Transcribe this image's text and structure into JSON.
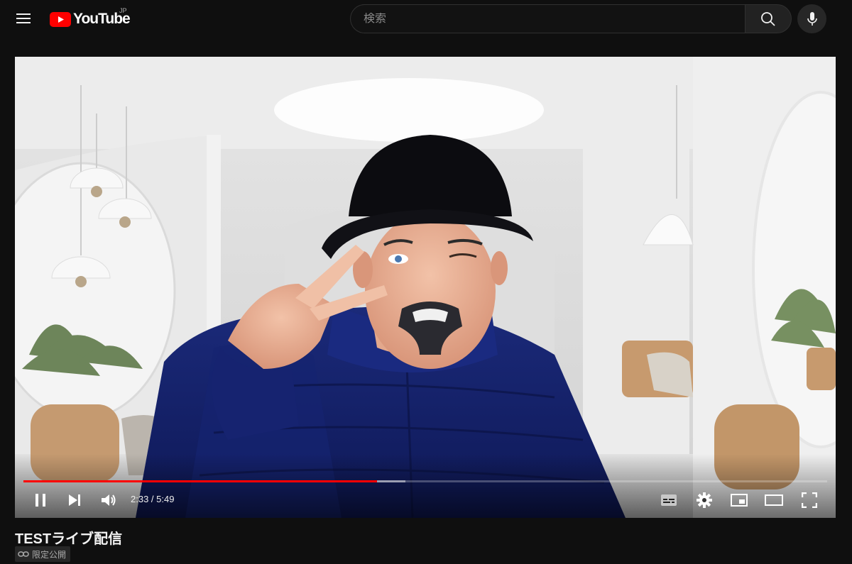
{
  "header": {
    "logo_text": "YouTube",
    "country_code": "JP",
    "search_placeholder": "検索"
  },
  "player": {
    "current_time": "2:33",
    "time_separator": " / ",
    "duration": "5:49",
    "played_fraction": 0.44,
    "buffered_fraction": 0.475
  },
  "video": {
    "title": "TESTライブ配信",
    "visibility_label": "限定公開"
  },
  "colors": {
    "accent": "#ff0000",
    "background": "#0f0f0f"
  },
  "icons": [
    "menu-icon",
    "youtube-logo-icon",
    "search-icon",
    "microphone-icon",
    "pause-icon",
    "next-icon",
    "volume-icon",
    "subtitles-icon",
    "settings-icon",
    "miniplayer-icon",
    "theater-icon",
    "fullscreen-icon",
    "link-icon"
  ]
}
